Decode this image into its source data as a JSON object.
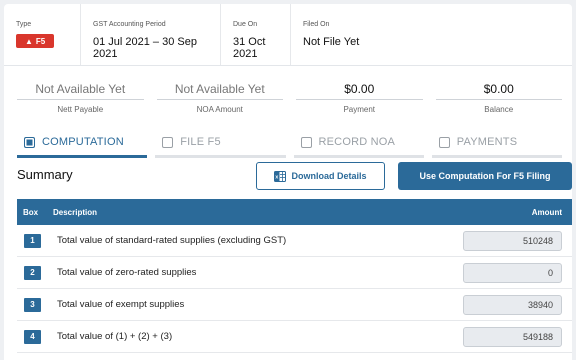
{
  "header": {
    "type_label": "Type",
    "type_badge": "F5",
    "period_label": "GST Accounting Period",
    "period_value": "01 Jul 2021 – 30 Sep 2021",
    "due_label": "Due On",
    "due_value": "31 Oct 2021",
    "filed_label": "Filed On",
    "filed_value": "Not File Yet"
  },
  "amounts": [
    {
      "value": "Not Available Yet",
      "label": "Nett Payable"
    },
    {
      "value": "Not Available Yet",
      "label": "NOA Amount"
    },
    {
      "value": "$0.00",
      "label": "Payment"
    },
    {
      "value": "$0.00",
      "label": "Balance"
    }
  ],
  "tabs": [
    {
      "label": "COMPUTATION",
      "active": true
    },
    {
      "label": "FILE F5",
      "active": false
    },
    {
      "label": "RECORD NOA",
      "active": false
    },
    {
      "label": "PAYMENTS",
      "active": false
    }
  ],
  "summary": {
    "title": "Summary",
    "download_label": "Download Details",
    "use_label": "Use Computation For F5 Filing"
  },
  "table": {
    "headers": {
      "box": "Box",
      "description": "Description",
      "amount": "Amount"
    },
    "rows": [
      {
        "box": "1",
        "description": "Total value of standard-rated supplies (excluding GST)",
        "amount": "510248"
      },
      {
        "box": "2",
        "description": "Total value of zero-rated supplies",
        "amount": "0"
      },
      {
        "box": "3",
        "description": "Total value of exempt supplies",
        "amount": "38940"
      },
      {
        "box": "4",
        "description": "Total value of (1) + (2) + (3)",
        "amount": "549188"
      }
    ]
  },
  "colors": {
    "accent": "#2b6a99",
    "badge": "#d9362c"
  },
  "icons": {
    "badge_icon": "warning-icon",
    "download_icon": "spreadsheet-icon"
  }
}
